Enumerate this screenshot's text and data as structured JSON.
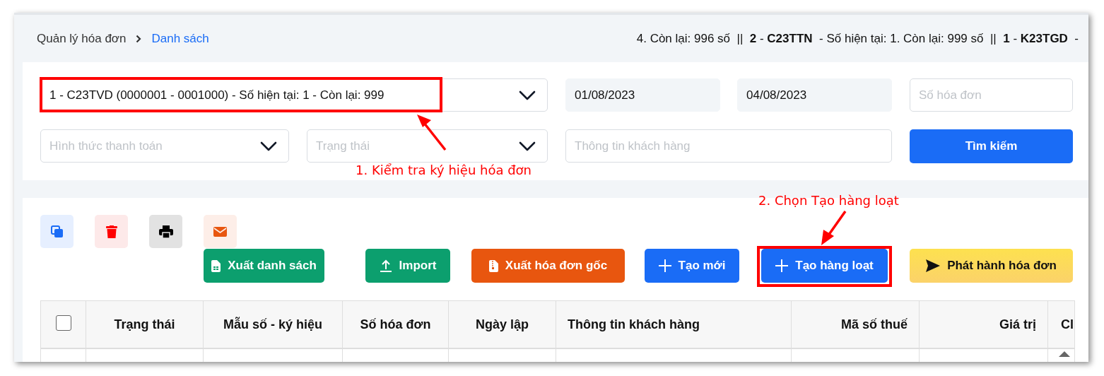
{
  "breadcrumb": {
    "items": [
      {
        "label": "Quản lý hóa đơn",
        "selected": false
      },
      {
        "label": "Danh sách",
        "selected": true
      }
    ]
  },
  "ticker": "4. Còn lại: 996 số  ||  **2** - **C23TTN**  - Số hiện tại: 1. Còn lại: 999 số  ||  **1** - **K23TGD**  -",
  "filters": {
    "symbol_select": {
      "value": "1 - C23TVD (0000001 - 0001000) - Số hiện tại: 1 - Còn lại: 999"
    },
    "date_from": {
      "value": "01/08/2023"
    },
    "date_to": {
      "value": "04/08/2023"
    },
    "invoice_number": {
      "placeholder": "Số hóa đơn"
    },
    "payment_method": {
      "placeholder": "Hình thức thanh toán"
    },
    "status": {
      "placeholder": "Trạng thái"
    },
    "customer_info": {
      "placeholder": "Thông tin khách hàng"
    },
    "search_button": "Tìm kiếm"
  },
  "icon_actions": [
    {
      "kind": "copy"
    },
    {
      "kind": "delete"
    },
    {
      "kind": "print"
    },
    {
      "kind": "email"
    }
  ],
  "actions": [
    {
      "label": "Xuất danh sách",
      "kind": "export"
    },
    {
      "label": "Import",
      "kind": "import"
    },
    {
      "label": "Xuất hóa đơn gốc",
      "kind": "original"
    },
    {
      "label": "Tạo mới",
      "kind": "create"
    },
    {
      "label": "Tạo hàng loạt",
      "kind": "batch"
    },
    {
      "label": "Phát hành hóa đơn",
      "kind": "issue"
    }
  ],
  "table": {
    "select_all": {
      "checked": false
    },
    "columns": [
      "Trạng thái",
      "Mẫu số - ký hiệu",
      "Số hóa đơn",
      "Ngày lập",
      "Thông tin khách hàng",
      "Mã số thuế",
      "Giá trị",
      "Cl"
    ]
  },
  "annotations": [
    {
      "label": "1. Kiểm tra ký hiệu hóa đơn"
    },
    {
      "label": "2. Chọn Tạo hàng loạt"
    }
  ]
}
